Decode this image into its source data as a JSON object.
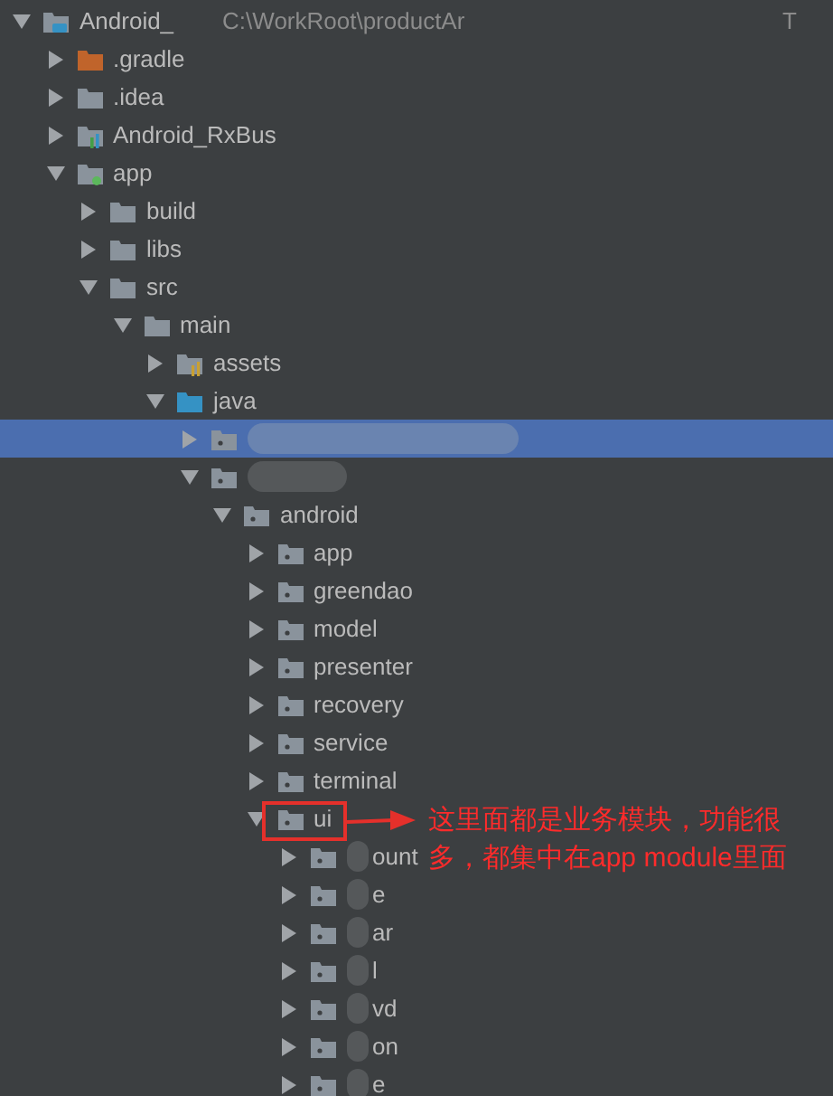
{
  "tree": [
    {
      "label": "Android_",
      "path": "C:\\WorkRoot\\productAr",
      "path_end": "T",
      "kind": "project",
      "expanded": true,
      "children": [
        {
          "label": ".gradle",
          "kind": "excluded",
          "expanded": false
        },
        {
          "label": ".idea",
          "kind": "folder",
          "expanded": false
        },
        {
          "label": "Android_RxBus",
          "kind": "module",
          "expanded": false
        },
        {
          "label": "app",
          "kind": "app-module",
          "expanded": true,
          "children": [
            {
              "label": "build",
              "kind": "folder",
              "expanded": false
            },
            {
              "label": "libs",
              "kind": "folder",
              "expanded": false
            },
            {
              "label": "src",
              "kind": "folder",
              "expanded": true,
              "children": [
                {
                  "label": "main",
                  "kind": "folder",
                  "expanded": true,
                  "children": [
                    {
                      "label": "assets",
                      "kind": "resources",
                      "expanded": false
                    },
                    {
                      "label": "java",
                      "kind": "source",
                      "expanded": true,
                      "children": [
                        {
                          "kind": "package",
                          "expanded": false,
                          "selected": true,
                          "redacted": true
                        },
                        {
                          "kind": "package",
                          "expanded": true,
                          "redacted": true,
                          "children": [
                            {
                              "label": "android",
                              "kind": "package",
                              "expanded": true,
                              "children": [
                                {
                                  "label": "app",
                                  "kind": "package",
                                  "expanded": false
                                },
                                {
                                  "label": "greendao",
                                  "kind": "package",
                                  "expanded": false
                                },
                                {
                                  "label": "model",
                                  "kind": "package",
                                  "expanded": false
                                },
                                {
                                  "label": "presenter",
                                  "kind": "package",
                                  "expanded": false
                                },
                                {
                                  "label": "recovery",
                                  "kind": "package",
                                  "expanded": false
                                },
                                {
                                  "label": "service",
                                  "kind": "package",
                                  "expanded": false
                                },
                                {
                                  "label": "terminal",
                                  "kind": "package",
                                  "expanded": false
                                },
                                {
                                  "label": "ui",
                                  "kind": "package",
                                  "expanded": true,
                                  "annotated": true,
                                  "children": [
                                    {
                                      "label": "ount",
                                      "kind": "package",
                                      "expanded": false,
                                      "redacted": true
                                    },
                                    {
                                      "label": "e",
                                      "kind": "package",
                                      "expanded": false,
                                      "redacted": true
                                    },
                                    {
                                      "label": "ar",
                                      "kind": "package",
                                      "expanded": false,
                                      "redacted": true
                                    },
                                    {
                                      "label": "l",
                                      "kind": "package",
                                      "expanded": false,
                                      "redacted": true
                                    },
                                    {
                                      "label": "vd",
                                      "kind": "package",
                                      "expanded": false,
                                      "redacted": true
                                    },
                                    {
                                      "label": "on",
                                      "kind": "package",
                                      "expanded": false,
                                      "redacted": true
                                    },
                                    {
                                      "label": "e",
                                      "kind": "package",
                                      "expanded": false,
                                      "redacted": true
                                    }
                                  ]
                                }
                              ]
                            }
                          ]
                        }
                      ]
                    }
                  ]
                }
              ]
            }
          ]
        }
      ]
    }
  ],
  "annotation": {
    "text": "这里面都是业务模块，功能很多，都集中在app module里面"
  }
}
